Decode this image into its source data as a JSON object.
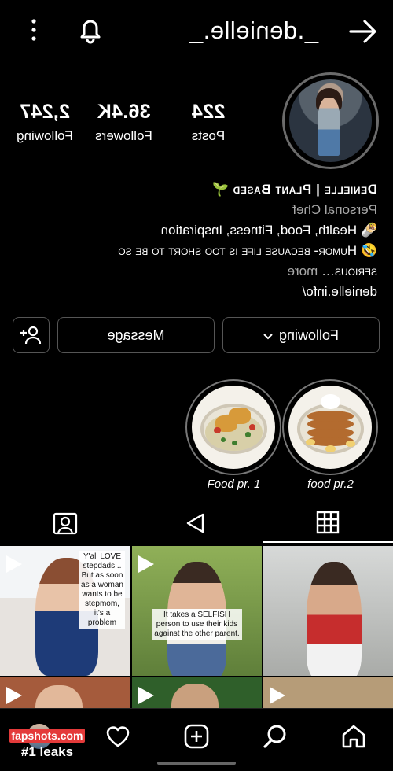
{
  "header": {
    "username": "_.denielle._",
    "icons": [
      "back-arrow-icon",
      "bell-icon",
      "more-vertical-icon"
    ]
  },
  "stats": {
    "posts": {
      "count": "224",
      "label": "Posts"
    },
    "followers": {
      "count": "36.4K",
      "label": "Followers"
    },
    "following": {
      "count": "2,247",
      "label": "Following"
    }
  },
  "bio": {
    "name": "Denielle | Plant Based",
    "name_emoji": "🌱",
    "category": "Personal Chef",
    "line1_emoji": "🌯",
    "line1": "Health, Food, Fitness, Inspiration",
    "line2_emoji": "🤣",
    "line2": "Humor- because life is too short to be so",
    "line3": "serious…",
    "more": "more",
    "link": "denielle.info/"
  },
  "actions": {
    "following_label": "Following",
    "message_label": "Message"
  },
  "highlights": [
    {
      "label": "food pr.2"
    },
    {
      "label": "Food pr. 1"
    }
  ],
  "posts_grid": [
    {
      "caption": "Y'all LOVE stepdads... But as soon as a woman wants to be stepmom, it's a problem",
      "type": "reel"
    },
    {
      "caption": "It takes a SELFISH person to use their kids against the other parent.",
      "type": "reel"
    },
    {
      "caption": "",
      "type": "photo"
    },
    {
      "caption": "",
      "type": "reel"
    },
    {
      "caption": "",
      "type": "reel"
    },
    {
      "caption": "",
      "type": "reel"
    }
  ],
  "watermark": {
    "line1": "fapshots.com",
    "line2": "#1 leaks"
  },
  "colors": {
    "background": "#000000",
    "text": "#ffffff",
    "muted": "#a8a8a8",
    "watermark_red": "#e43a3a"
  }
}
